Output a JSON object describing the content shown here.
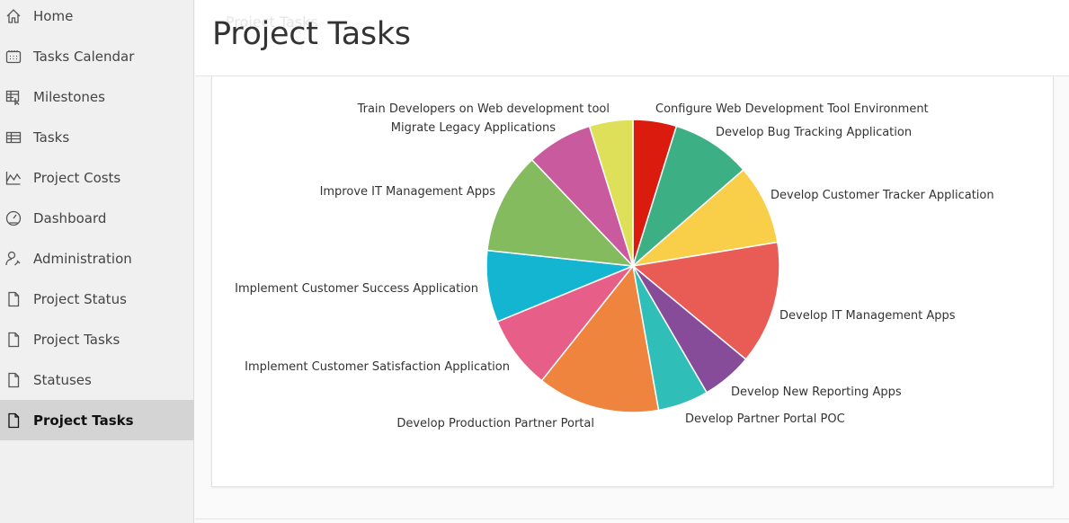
{
  "sidebar": {
    "items": [
      {
        "label": "Home",
        "icon": "home-icon",
        "active": false
      },
      {
        "label": "Tasks Calendar",
        "icon": "calendar-icon",
        "active": false
      },
      {
        "label": "Milestones",
        "icon": "milestones-icon",
        "active": false
      },
      {
        "label": "Tasks",
        "icon": "table-icon",
        "active": false
      },
      {
        "label": "Project Costs",
        "icon": "line-chart-icon",
        "active": false
      },
      {
        "label": "Dashboard",
        "icon": "dashboard-gauge-icon",
        "active": false
      },
      {
        "label": "Administration",
        "icon": "admin-user-wrench-icon",
        "active": false
      },
      {
        "label": "Project Status",
        "icon": "page-icon",
        "active": false
      },
      {
        "label": "Project Tasks",
        "icon": "page-icon",
        "active": false
      },
      {
        "label": "Statuses",
        "icon": "page-icon",
        "active": false
      },
      {
        "label": "Project Tasks",
        "icon": "page-icon",
        "active": true
      }
    ]
  },
  "header": {
    "ghost_title": "Project Tasks",
    "title": "Project Tasks"
  },
  "chart_data": {
    "type": "pie",
    "title": "",
    "start": "top, clockwise",
    "slices": [
      {
        "label": "Configure Web Development Tool Environment",
        "percent": 4.8,
        "color": "#dc1b0f"
      },
      {
        "label": "Develop Bug Tracking Application",
        "percent": 8.8,
        "color": "#3daf85"
      },
      {
        "label": "Develop Customer Tracker Application",
        "percent": 8.8,
        "color": "#f9ce48"
      },
      {
        "label": "Develop IT Management Apps",
        "percent": 13.6,
        "color": "#e85c55"
      },
      {
        "label": "Develop New Reporting Apps",
        "percent": 5.6,
        "color": "#864c9a"
      },
      {
        "label": "Develop Partner Portal POC",
        "percent": 5.6,
        "color": "#2fbfb8"
      },
      {
        "label": "Develop Production Partner Portal",
        "percent": 13.5,
        "color": "#ee843d"
      },
      {
        "label": "Implement Customer Satisfaction Application",
        "percent": 8.1,
        "color": "#e75e88"
      },
      {
        "label": "Implement Customer Success Application",
        "percent": 7.9,
        "color": "#14b5d0"
      },
      {
        "label": "Improve IT Management Apps",
        "percent": 11.2,
        "color": "#83bb5e"
      },
      {
        "label": "Migrate Legacy Applications",
        "percent": 7.3,
        "color": "#c95a9e"
      },
      {
        "label": "Train Developers on Web development tool",
        "percent": 4.8,
        "color": "#dee05a"
      }
    ],
    "legend": "none (labels outside slices)"
  }
}
